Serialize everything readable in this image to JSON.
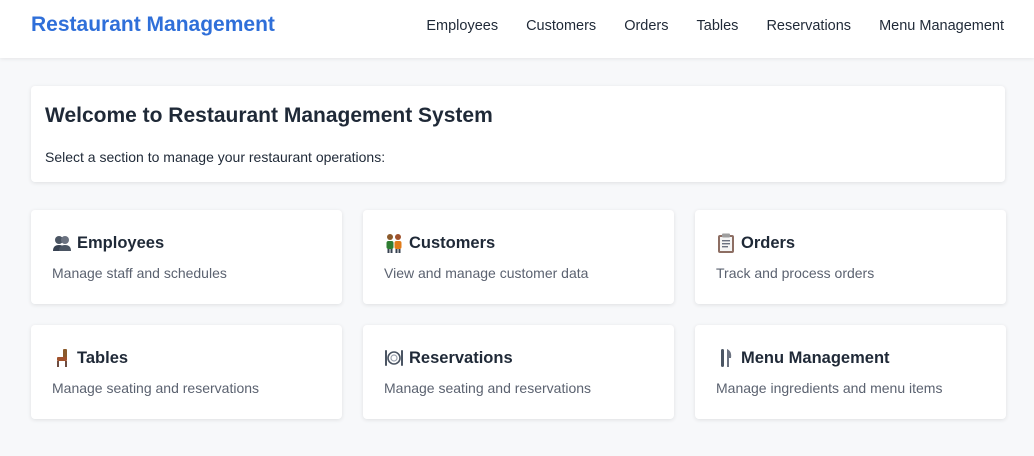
{
  "navbar": {
    "brand": "Restaurant Management",
    "links": [
      "Employees",
      "Customers",
      "Orders",
      "Tables",
      "Reservations",
      "Menu Management"
    ]
  },
  "welcome": {
    "title": "Welcome to Restaurant Management System",
    "subtitle": "Select a section to manage your restaurant operations:"
  },
  "cards": [
    {
      "title": "Employees",
      "description": "Manage staff and schedules",
      "icon": "people-icon"
    },
    {
      "title": "Customers",
      "description": "View and manage customer data",
      "icon": "customers-icon"
    },
    {
      "title": "Orders",
      "description": "Track and process orders",
      "icon": "clipboard-icon"
    },
    {
      "title": "Tables",
      "description": "Manage seating and reservations",
      "icon": "chair-icon"
    },
    {
      "title": "Reservations",
      "description": "Manage seating and reservations",
      "icon": "plate-icon"
    },
    {
      "title": "Menu Management",
      "description": "Manage ingredients and menu items",
      "icon": "utensils-icon"
    }
  ],
  "colors": {
    "brand": "#2f6fd9",
    "background": "#f7f8fa",
    "card": "#ffffff"
  }
}
